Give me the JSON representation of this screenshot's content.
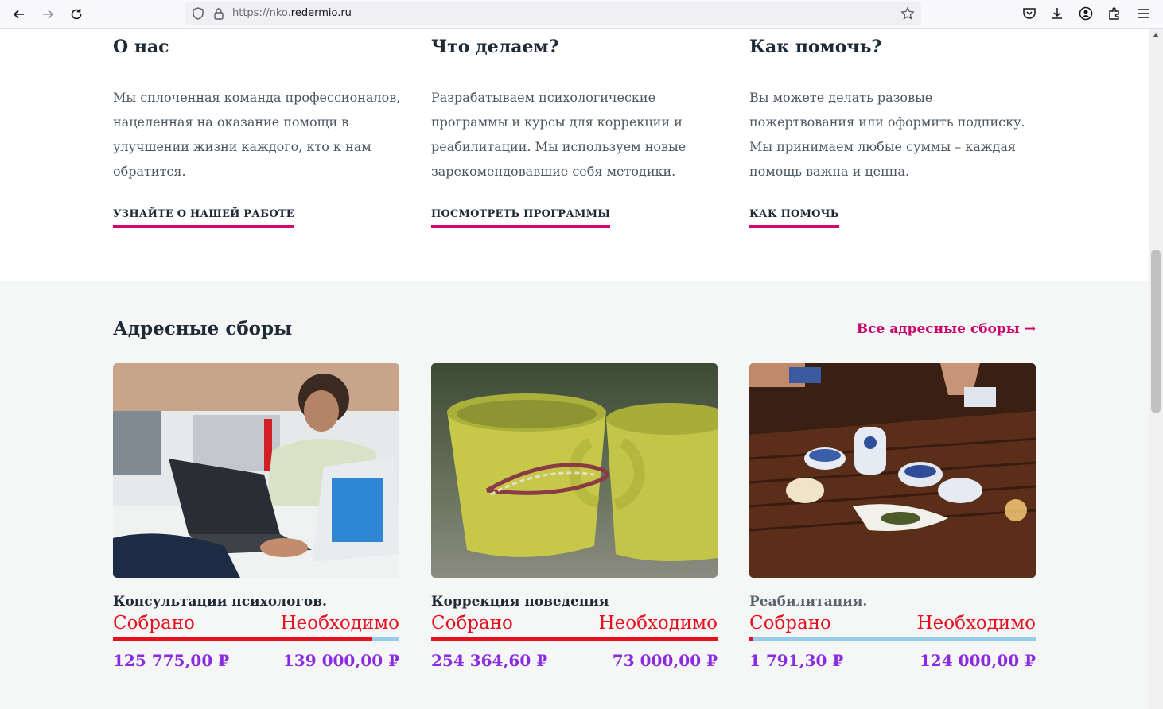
{
  "browser": {
    "url_prefix": "https://nko.",
    "url_domain": "redermio.ru"
  },
  "info": [
    {
      "title": "О нас",
      "text": "Мы сплоченная команда профессионалов, нацеленная на оказание помощи в улучшении жизни каждого, кто к нам обратится.",
      "link": "УЗНАЙТЕ О НАШЕЙ РАБОТЕ"
    },
    {
      "title": "Что делаем?",
      "text": "Разрабатываем психологические программы и курсы для коррекции и реабилитации. Мы используем новые зарекомендовавшие себя методики.",
      "link": "ПОСМОТРЕТЬ ПРОГРАММЫ"
    },
    {
      "title": "Как помочь?",
      "text": "Вы можете делать разовые пожертвования или оформить подписку. Мы принимаем любые суммы – каждая помощь важна и ценна.",
      "link": "КАК ПОМОЧЬ"
    }
  ],
  "fundraisers": {
    "title": "Адресные сборы",
    "all_link": "Все адресные сборы →",
    "collected_label": "Собрано",
    "needed_label": "Необходимо",
    "cards": [
      {
        "title": "Консультации психологов.",
        "collected": "125 775,00 ₽",
        "needed": "139 000,00 ₽",
        "progress": 0.905
      },
      {
        "title": "Коррекция поведения",
        "collected": "254 364,60 ₽",
        "needed": "73 000,00 ₽",
        "progress": 1.0
      },
      {
        "title": "Реабилитация.",
        "collected": "1 791,30 ₽",
        "needed": "124 000,00 ₽",
        "progress": 0.014
      }
    ]
  },
  "colors": {
    "accent": "#d6076f",
    "collected_red": "#e8101f",
    "amount_purple": "#8a2be2",
    "progress_bg": "#96cbea"
  }
}
